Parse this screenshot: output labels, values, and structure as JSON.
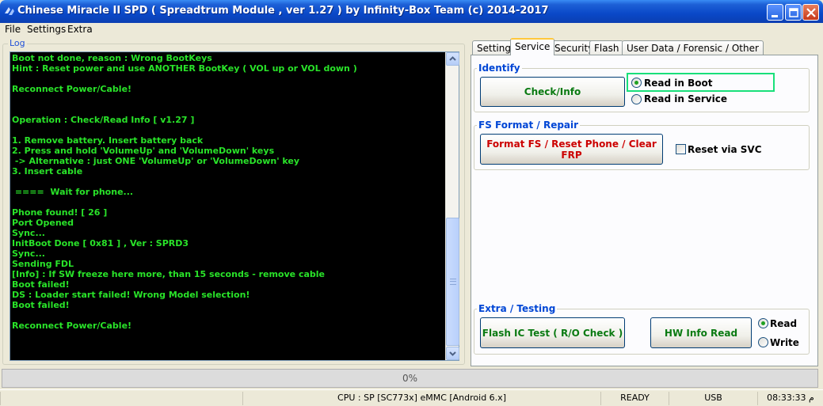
{
  "window": {
    "title": "Chinese Miracle II SPD ( Spreadtrum Module , ver 1.27 ) by Infinity-Box Team (c) 2014-2017"
  },
  "menu": [
    "File",
    "Settings",
    "Extra"
  ],
  "log": {
    "legend": "Log",
    "lines": [
      "Boot not done, reason : Wrong BootKeys",
      "Hint : Reset power and use ANOTHER BootKey ( VOL up or VOL down )",
      "",
      "Reconnect Power/Cable!",
      "",
      "",
      "Operation : Check/Read Info [ v1.27 ]",
      "",
      "1. Remove battery. Insert battery back",
      "2. Press and hold 'VolumeUp' and 'VolumeDown' keys",
      " -> Alternative : just ONE 'VolumeUp' or 'VolumeDown' key",
      "3. Insert cable",
      "",
      " ====  Wait for phone...",
      "",
      "Phone found! [ 26 ]",
      "Port Opened",
      "Sync...",
      "InitBoot Done [ 0x81 ] , Ver : SPRD3",
      "Sync...",
      "Sending FDL",
      "[Info] : If SW freeze here more, than 15 seconds - remove cable",
      "Boot failed!",
      "DS : Loader start failed! Wrong Model selection!",
      "Boot failed!",
      "",
      "Reconnect Power/Cable!"
    ]
  },
  "tabs": [
    "Settings",
    "Service",
    "Security",
    "Flash",
    "User Data / Forensic / Other"
  ],
  "active_tab": "Service",
  "identify": {
    "legend": "Identify",
    "button": "Check/Info",
    "radio_boot": "Read in Boot",
    "radio_service": "Read in Service",
    "selected": "Read in Boot"
  },
  "fs_format": {
    "legend": "FS Format / Repair",
    "button": "Format FS / Reset Phone / Clear FRP",
    "checkbox_label": "Reset via SVC",
    "checked": false
  },
  "extra_testing": {
    "legend": "Extra / Testing",
    "flash_button": "Flash IC Test ( R/O Check )",
    "hw_button": "HW Info Read",
    "radio_read": "Read",
    "radio_write": "Write",
    "selected": "Read"
  },
  "progress": {
    "text": "0%",
    "value": 0
  },
  "status": {
    "cpu": "CPU : SP [SC773x] eMMC [Android 6.x]",
    "state": "READY",
    "port": "USB",
    "time": "08:33:33 م"
  },
  "colors": {
    "titlebar": "#0a48c8",
    "log_bg": "#000000",
    "log_text": "#29e329",
    "legend_blue": "#0046d5",
    "green_button_text": "#0a7a12",
    "red_button_text": "#cc0000",
    "highlight": "#19e07a"
  }
}
